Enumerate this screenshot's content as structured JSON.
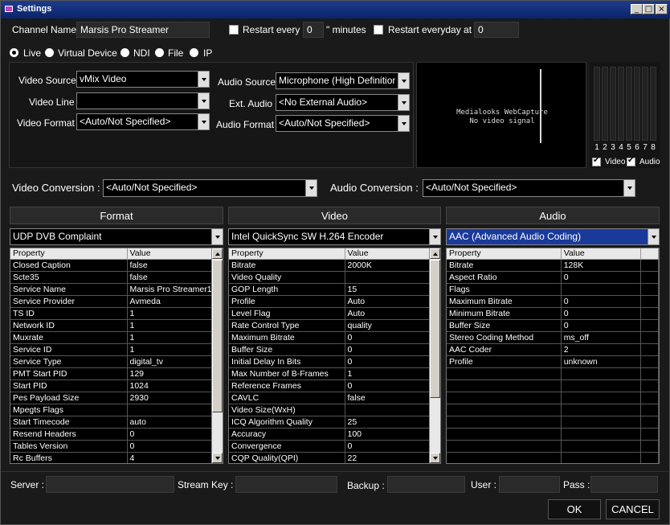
{
  "window": {
    "title": "Settings",
    "min_label": "_",
    "max_label": "□",
    "close_label": "×"
  },
  "channel": {
    "label": "Channel Name :",
    "value": "Marsis Pro Streamer"
  },
  "restart": {
    "every_label": "Restart every \"",
    "every_value": "0",
    "minutes_label": "\" minutes",
    "everyday_label": "Restart everyday at :",
    "everyday_value": "0"
  },
  "sources": [
    "Live",
    "Virtual Device",
    "NDI",
    "File",
    "IP"
  ],
  "video": {
    "source_label": "Video Source :",
    "source_value": "vMix Video",
    "line_label": "Video Line :",
    "line_value": "",
    "format_label": "Video Format :",
    "format_value": "<Auto/Not Specified>"
  },
  "audio": {
    "source_label": "Audio Source :",
    "source_value": "Microphone (High Definition A",
    "ext_label": "Ext. Audio :",
    "ext_value": "<No External Audio>",
    "format_label": "Audio Format :",
    "format_value": "<Auto/Not Specified>"
  },
  "preview": {
    "line1": "Medialooks WebCapture",
    "line2": "No video signal"
  },
  "meters": {
    "channels": [
      "1",
      "2",
      "3",
      "4",
      "5",
      "6",
      "7",
      "8"
    ],
    "video_label": "Video",
    "audio_label": "Audio"
  },
  "conversion": {
    "video_label": "Video Conversion :",
    "video_value": "<Auto/Not Specified>",
    "audio_label": "Audio Conversion :",
    "audio_value": "<Auto/Not Specified>"
  },
  "panels": {
    "format": {
      "title": "Format",
      "selected": "UDP DVB Complaint",
      "columns": [
        "Property",
        "Value"
      ],
      "rows": [
        [
          "Closed Caption",
          "false"
        ],
        [
          "Scte35",
          "false"
        ],
        [
          "Service Name",
          "Marsis Pro Streamer1"
        ],
        [
          "Service Provider",
          "Avmeda"
        ],
        [
          "TS ID",
          "1"
        ],
        [
          "Network ID",
          "1"
        ],
        [
          "Muxrate",
          "1"
        ],
        [
          "Service ID",
          "1"
        ],
        [
          "Service Type",
          "digital_tv"
        ],
        [
          "PMT Start PID",
          "129"
        ],
        [
          "Start PID",
          "1024"
        ],
        [
          "Pes Payload Size",
          "2930"
        ],
        [
          "Mpegts Flags",
          ""
        ],
        [
          "Start Timecode",
          "auto"
        ],
        [
          "Resend Headers",
          "0"
        ],
        [
          "Tables Version",
          "0"
        ],
        [
          "Rc Buffers",
          "4"
        ]
      ]
    },
    "video": {
      "title": "Video",
      "selected": "Intel QuickSync SW H.264 Encoder",
      "columns": [
        "Property",
        "Value"
      ],
      "rows": [
        [
          "Bitrate",
          "2000K"
        ],
        [
          "Video Quality",
          ""
        ],
        [
          "GOP Length",
          "15"
        ],
        [
          "Profile",
          "Auto"
        ],
        [
          "Level Flag",
          "Auto"
        ],
        [
          "Rate Control Type",
          "quality"
        ],
        [
          "Maximum Bitrate",
          "0"
        ],
        [
          "Buffer Size",
          "0"
        ],
        [
          "Initial Delay In Bits",
          "0"
        ],
        [
          "Max Number of B-Frames",
          "1"
        ],
        [
          "Reference Frames",
          "0"
        ],
        [
          "CAVLC",
          "false"
        ],
        [
          "Video Size(WxH)",
          ""
        ],
        [
          "ICQ Algorithm Quality",
          "25"
        ],
        [
          "Accuracy",
          "100"
        ],
        [
          "Convergence",
          "0"
        ],
        [
          "CQP Quality(QPI)",
          "22"
        ]
      ]
    },
    "audio": {
      "title": "Audio",
      "selected": "AAC (Advanced Audio Coding)",
      "columns": [
        "Property",
        "Value"
      ],
      "rows": [
        [
          "Bitrate",
          "128K"
        ],
        [
          "Aspect Ratio",
          "0"
        ],
        [
          "Flags",
          ""
        ],
        [
          "Maximum Bitrate",
          "0"
        ],
        [
          "Minimum Bitrate",
          "0"
        ],
        [
          "Buffer Size",
          "0"
        ],
        [
          "Stereo Coding Method",
          "ms_off"
        ],
        [
          "AAC Coder",
          "2"
        ],
        [
          "Profile",
          "unknown"
        ],
        [
          "",
          ""
        ],
        [
          "",
          ""
        ],
        [
          "",
          ""
        ],
        [
          "",
          ""
        ],
        [
          "",
          ""
        ],
        [
          "",
          ""
        ],
        [
          "",
          ""
        ],
        [
          "",
          ""
        ]
      ]
    }
  },
  "footer": {
    "server_label": "Server :",
    "server_value": "",
    "key_label": "Stream Key :",
    "key_value": "",
    "backup_label": "Backup :",
    "backup_value": "",
    "user_label": "User :",
    "user_value": "",
    "pass_label": "Pass :",
    "pass_value": "",
    "ok_label": "OK",
    "cancel_label": "CANCEL"
  }
}
